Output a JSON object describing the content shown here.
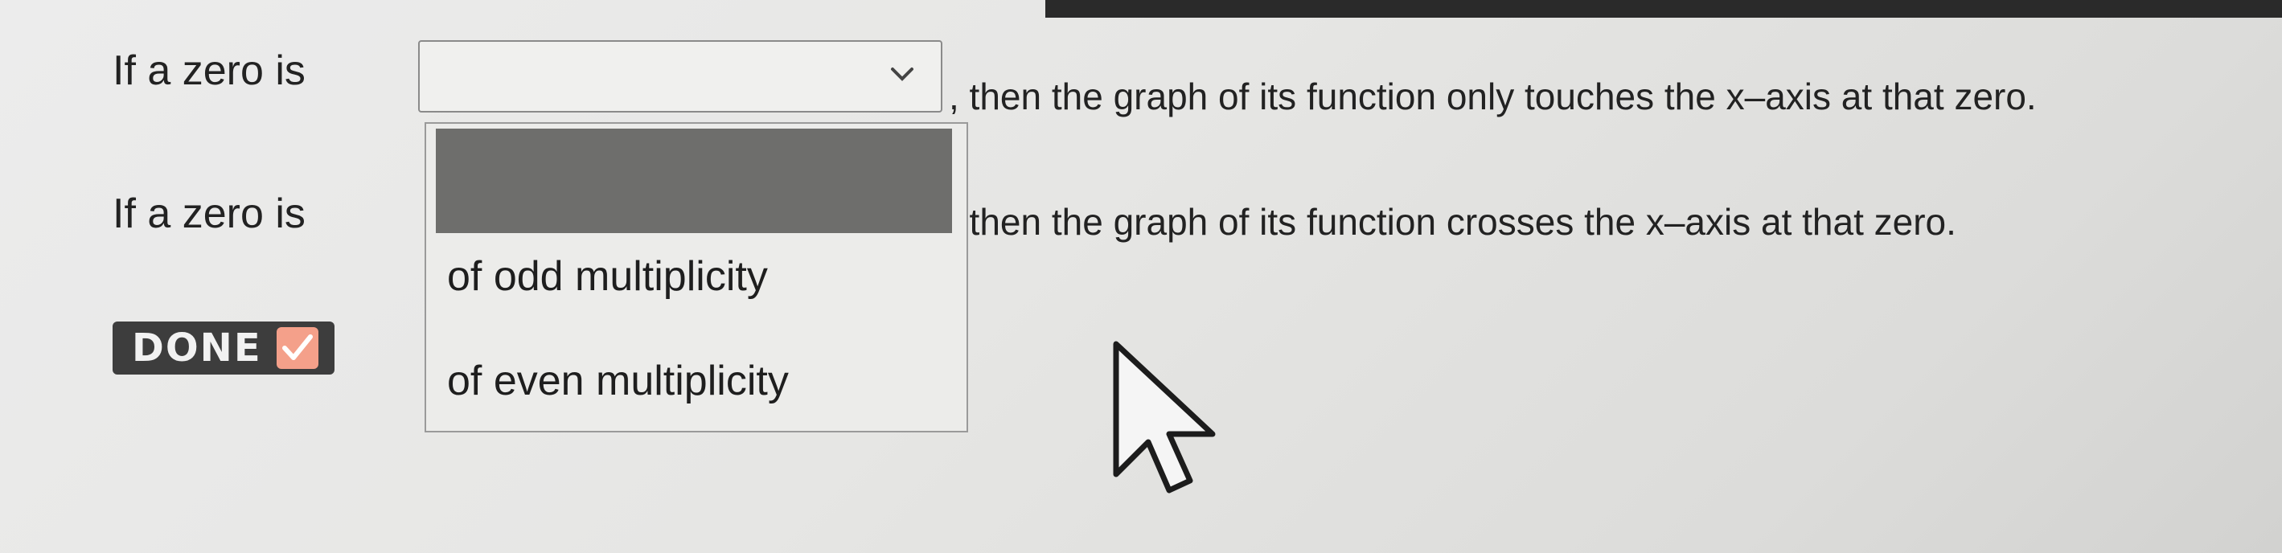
{
  "question": {
    "line1_prefix": "If a zero is",
    "line1_suffix": ", then the graph of its function only touches the x–axis at that zero.",
    "line2_prefix": "If a zero is",
    "line2_suffix": ", then the graph of its function crosses the x–axis at that zero."
  },
  "dropdown": {
    "selected_value": "",
    "options": [
      "of odd multiplicity",
      "of even multiplicity"
    ],
    "icon": "chevron-down-icon"
  },
  "status": {
    "done_label": "DONE",
    "done_icon": "checkmark-icon",
    "check_color": "#f4a08a"
  },
  "cursor": {
    "icon": "mouse-pointer-icon"
  }
}
